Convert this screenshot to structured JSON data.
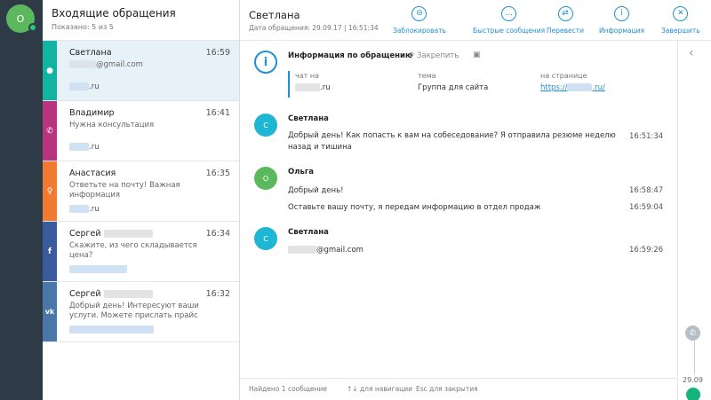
{
  "rail": {
    "avatar_letter": "О"
  },
  "list": {
    "title": "Входящие обращения",
    "shown": "Показано: 5 из 5",
    "items": [
      {
        "name": "Светлана",
        "time": "16:59",
        "line1": "@gmail.com",
        "line2": "",
        "site": ".ru",
        "channel_icon": "chat-icon",
        "color": "#12b3a1"
      },
      {
        "name": "Владимир",
        "time": "16:41",
        "line1": "Нужна консультация",
        "line2": "",
        "site": ".ru",
        "channel_icon": "phone-icon",
        "color": "#b8347e"
      },
      {
        "name": "Анастасия",
        "time": "16:35",
        "line1": "Ответьте на почту! Важная",
        "line2": "информация",
        "site": ".ru",
        "channel_icon": "odnoklassniki-icon",
        "color": "#f07a31"
      },
      {
        "name": "Сергей",
        "time": "16:34",
        "line1": "Скажите, из чего складывается",
        "line2": "цена?",
        "site": "",
        "channel_icon": "facebook-icon",
        "color": "#3b5c9c"
      },
      {
        "name": "Сергей",
        "time": "16:32",
        "line1": "Добрый день! Интересуют ваши",
        "line2": "услуги. Можете прислать прайс",
        "site": "",
        "channel_icon": "vk-icon",
        "color": "#4a76a8"
      }
    ]
  },
  "header": {
    "name": "Светлана",
    "date": "Дата обращения: 29.09.17 | 16:51:34",
    "tools": [
      {
        "label": "Заблокировать",
        "icon": "block-icon"
      },
      {
        "label": "Быстрые сообщения",
        "icon": "quick-messages-icon"
      },
      {
        "label": "Перевести",
        "icon": "transfer-icon"
      },
      {
        "label": "Информация",
        "icon": "info-icon"
      },
      {
        "label": "Завершить",
        "icon": "close-icon"
      }
    ]
  },
  "info": {
    "title": "Информация по обращению",
    "pin_label": "Закрепить",
    "chat_label": "чат на",
    "chat_value": ".ru",
    "topic_label": "тема",
    "topic_value": "Группа для сайта",
    "page_label": "на странице",
    "page_value": "https://",
    "page_suffix": ".ru/"
  },
  "messages": [
    {
      "author": "Светлана",
      "avatar": "С",
      "color": "#1fb6d4",
      "texts": [
        "Добрый день! Как попасть к вам на собеседование? Я отправила резюме неделю назад и тишина"
      ],
      "times": [
        "16:51:34"
      ]
    },
    {
      "author": "Ольга",
      "avatar": "О",
      "color": "#5cb85c",
      "texts": [
        "Добрый день!",
        "Оставьте вашу почту, я передам информацию в отдел продаж"
      ],
      "times": [
        "16:58:47",
        "16:59:04"
      ]
    },
    {
      "author": "Светлана",
      "avatar": "С",
      "color": "#1fb6d4",
      "texts": [
        "@gmail.com"
      ],
      "times": [
        "16:59:26"
      ]
    }
  ],
  "footer": {
    "found": "Найдено 1 сообщение",
    "nav": "для навигации",
    "esc": "Esc для закрытия"
  },
  "side": {
    "date": "29.09"
  }
}
